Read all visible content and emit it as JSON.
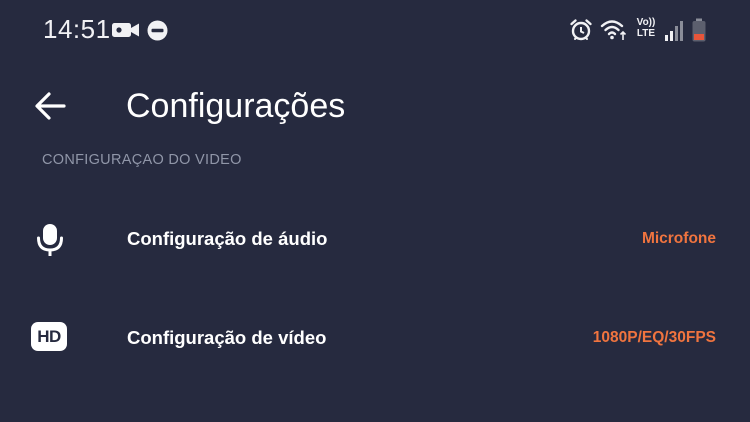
{
  "status_bar": {
    "time": "14:51",
    "left_icons": [
      "video-camera-icon",
      "do-not-disturb-icon"
    ],
    "right_icons": [
      "alarm-icon",
      "wifi-icon",
      "volte-icon",
      "signal-icon",
      "battery-icon"
    ],
    "volte_text_top": "Vo))",
    "volte_text_bottom": "LTE",
    "battery_color": "#e8553a"
  },
  "header": {
    "back_icon": "arrow-left-icon",
    "title": "Configurações"
  },
  "section": {
    "title": "CONFIGURAÇAO DO VIDEO"
  },
  "settings": [
    {
      "icon": "microphone-icon",
      "label": "Configuração de áudio",
      "value": "Microfone"
    },
    {
      "icon": "hd-icon",
      "icon_text": "HD",
      "label": "Configuração de vídeo",
      "value": "1080P/EQ/30FPS"
    }
  ],
  "colors": {
    "background": "#262a3f",
    "accent": "#f0743f",
    "section_text": "#9096a8"
  }
}
